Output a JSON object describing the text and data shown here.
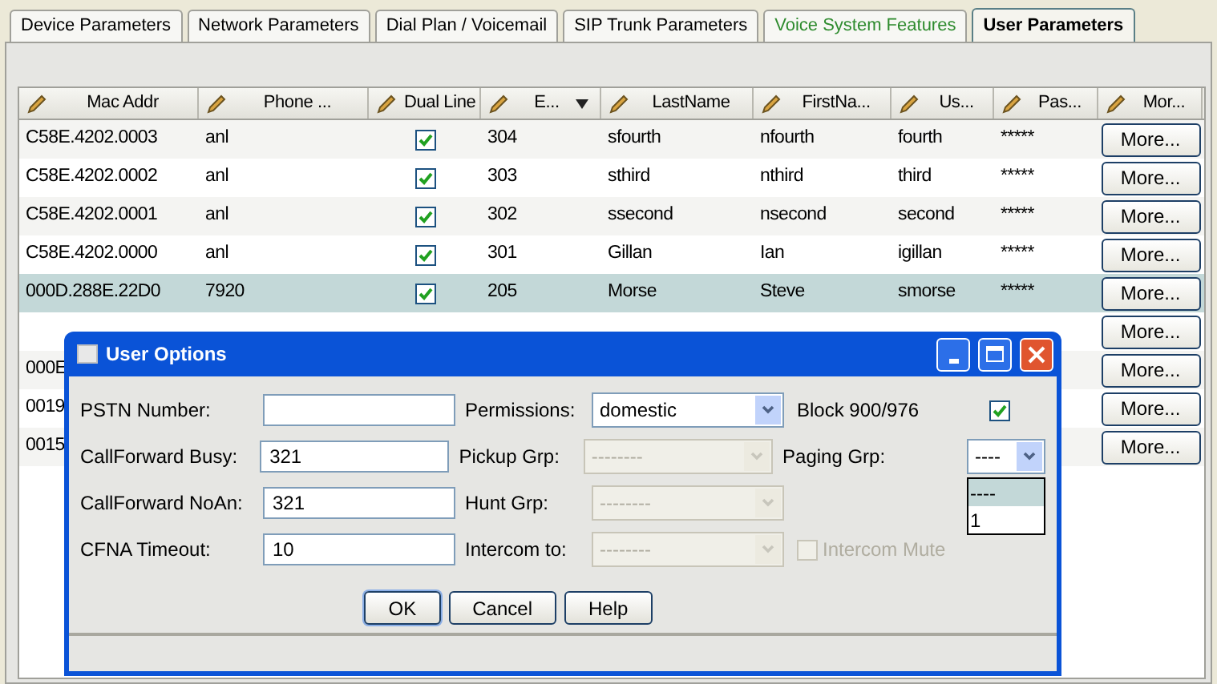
{
  "tabs": [
    {
      "label": "Device Parameters",
      "selected": false,
      "color": "#000000"
    },
    {
      "label": "Network Parameters",
      "selected": false,
      "color": "#000000"
    },
    {
      "label": "Dial Plan / Voicemail",
      "selected": false,
      "color": "#000000"
    },
    {
      "label": "SIP Trunk Parameters",
      "selected": false,
      "color": "#000000"
    },
    {
      "label": "Voice System Features",
      "selected": false,
      "color": "#2e8b2e"
    },
    {
      "label": "User Parameters",
      "selected": true,
      "color": "#000000"
    }
  ],
  "table": {
    "columns": [
      {
        "label": "Mac Addr",
        "sorted": false
      },
      {
        "label": "Phone ...",
        "sorted": false
      },
      {
        "label": "Dual Line",
        "sorted": false
      },
      {
        "label": "E...",
        "sorted": true
      },
      {
        "label": "LastName",
        "sorted": false
      },
      {
        "label": "FirstNa...",
        "sorted": false
      },
      {
        "label": "Us...",
        "sorted": false
      },
      {
        "label": "Pas...",
        "sorted": false
      },
      {
        "label": "Mor...",
        "sorted": false
      }
    ],
    "rows": [
      {
        "cells": [
          "C58E.4202.0003",
          "anl",
          "304",
          "sfourth",
          "nfourth",
          "fourth",
          "*****"
        ],
        "dual_line": true,
        "selected": false,
        "more": "More..."
      },
      {
        "cells": [
          "C58E.4202.0002",
          "anl",
          "303",
          "sthird",
          "nthird",
          "third",
          "*****"
        ],
        "dual_line": true,
        "selected": false,
        "more": "More..."
      },
      {
        "cells": [
          "C58E.4202.0001",
          "anl",
          "302",
          "ssecond",
          "nsecond",
          "second",
          "*****"
        ],
        "dual_line": true,
        "selected": false,
        "more": "More..."
      },
      {
        "cells": [
          "C58E.4202.0000",
          "anl",
          "301",
          "Gillan",
          "Ian",
          "igillan",
          "*****"
        ],
        "dual_line": true,
        "selected": false,
        "more": "More..."
      },
      {
        "cells": [
          "000D.288E.22D0",
          "7920",
          "205",
          "Morse",
          "Steve",
          "smorse",
          "*****"
        ],
        "dual_line": true,
        "selected": true,
        "more": "More..."
      },
      {
        "selected": false,
        "more": "More..."
      },
      {
        "cells": [
          "000E"
        ],
        "selected": false,
        "more": "More..."
      },
      {
        "cells": [
          "0019"
        ],
        "selected": false,
        "more": "More..."
      },
      {
        "cells": [
          "0015"
        ],
        "selected": false,
        "more": "More..."
      }
    ]
  },
  "dialog": {
    "title": "User Options",
    "rows": [
      {
        "field": {
          "label": "PSTN Number:"
        },
        "select": {
          "label": "Permissions:",
          "value": "domestic",
          "disabled": false
        },
        "extra": {
          "kind": "checkbox",
          "label": "Block 900/976",
          "checked": true,
          "disabled": false
        }
      },
      {
        "field": {
          "label": "CallForward Busy:",
          "value": "321"
        },
        "select": {
          "label": "Pickup Grp:",
          "value": "--------",
          "disabled": true
        },
        "extra": {
          "kind": "dropdown",
          "label": "Paging Grp:",
          "value": "----",
          "options": [
            {
              "label": "----",
              "selected": true
            },
            {
              "label": "1",
              "selected": false
            }
          ]
        }
      },
      {
        "field": {
          "label": "CallForward NoAn:",
          "value": "321"
        },
        "select": {
          "label": "Hunt Grp:",
          "value": "--------",
          "disabled": true
        }
      },
      {
        "field": {
          "label": "CFNA Timeout:",
          "value": "10"
        },
        "select": {
          "label": "Intercom to:",
          "value": "--------",
          "disabled": true
        },
        "extra": {
          "kind": "checkbox",
          "label": "Intercom Mute",
          "checked": false,
          "disabled": true
        }
      }
    ],
    "buttons": [
      {
        "label": "OK",
        "default": true
      },
      {
        "label": "Cancel",
        "default": false
      },
      {
        "label": "Help",
        "default": false
      }
    ]
  }
}
